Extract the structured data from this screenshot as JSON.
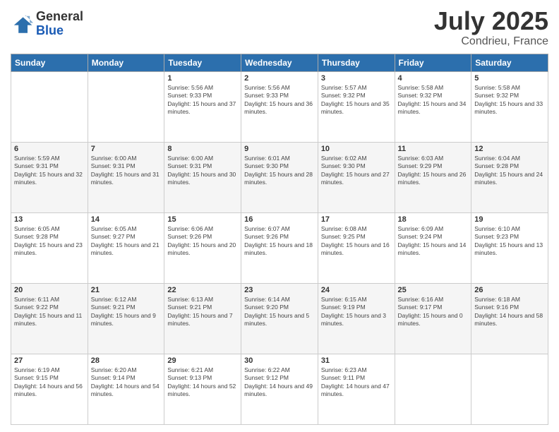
{
  "logo": {
    "general": "General",
    "blue": "Blue"
  },
  "title": {
    "month_year": "July 2025",
    "location": "Condrieu, France"
  },
  "headers": [
    "Sunday",
    "Monday",
    "Tuesday",
    "Wednesday",
    "Thursday",
    "Friday",
    "Saturday"
  ],
  "weeks": [
    [
      {
        "day": "",
        "info": ""
      },
      {
        "day": "",
        "info": ""
      },
      {
        "day": "1",
        "info": "Sunrise: 5:56 AM\nSunset: 9:33 PM\nDaylight: 15 hours and 37 minutes."
      },
      {
        "day": "2",
        "info": "Sunrise: 5:56 AM\nSunset: 9:33 PM\nDaylight: 15 hours and 36 minutes."
      },
      {
        "day": "3",
        "info": "Sunrise: 5:57 AM\nSunset: 9:32 PM\nDaylight: 15 hours and 35 minutes."
      },
      {
        "day": "4",
        "info": "Sunrise: 5:58 AM\nSunset: 9:32 PM\nDaylight: 15 hours and 34 minutes."
      },
      {
        "day": "5",
        "info": "Sunrise: 5:58 AM\nSunset: 9:32 PM\nDaylight: 15 hours and 33 minutes."
      }
    ],
    [
      {
        "day": "6",
        "info": "Sunrise: 5:59 AM\nSunset: 9:31 PM\nDaylight: 15 hours and 32 minutes."
      },
      {
        "day": "7",
        "info": "Sunrise: 6:00 AM\nSunset: 9:31 PM\nDaylight: 15 hours and 31 minutes."
      },
      {
        "day": "8",
        "info": "Sunrise: 6:00 AM\nSunset: 9:31 PM\nDaylight: 15 hours and 30 minutes."
      },
      {
        "day": "9",
        "info": "Sunrise: 6:01 AM\nSunset: 9:30 PM\nDaylight: 15 hours and 28 minutes."
      },
      {
        "day": "10",
        "info": "Sunrise: 6:02 AM\nSunset: 9:30 PM\nDaylight: 15 hours and 27 minutes."
      },
      {
        "day": "11",
        "info": "Sunrise: 6:03 AM\nSunset: 9:29 PM\nDaylight: 15 hours and 26 minutes."
      },
      {
        "day": "12",
        "info": "Sunrise: 6:04 AM\nSunset: 9:28 PM\nDaylight: 15 hours and 24 minutes."
      }
    ],
    [
      {
        "day": "13",
        "info": "Sunrise: 6:05 AM\nSunset: 9:28 PM\nDaylight: 15 hours and 23 minutes."
      },
      {
        "day": "14",
        "info": "Sunrise: 6:05 AM\nSunset: 9:27 PM\nDaylight: 15 hours and 21 minutes."
      },
      {
        "day": "15",
        "info": "Sunrise: 6:06 AM\nSunset: 9:26 PM\nDaylight: 15 hours and 20 minutes."
      },
      {
        "day": "16",
        "info": "Sunrise: 6:07 AM\nSunset: 9:26 PM\nDaylight: 15 hours and 18 minutes."
      },
      {
        "day": "17",
        "info": "Sunrise: 6:08 AM\nSunset: 9:25 PM\nDaylight: 15 hours and 16 minutes."
      },
      {
        "day": "18",
        "info": "Sunrise: 6:09 AM\nSunset: 9:24 PM\nDaylight: 15 hours and 14 minutes."
      },
      {
        "day": "19",
        "info": "Sunrise: 6:10 AM\nSunset: 9:23 PM\nDaylight: 15 hours and 13 minutes."
      }
    ],
    [
      {
        "day": "20",
        "info": "Sunrise: 6:11 AM\nSunset: 9:22 PM\nDaylight: 15 hours and 11 minutes."
      },
      {
        "day": "21",
        "info": "Sunrise: 6:12 AM\nSunset: 9:21 PM\nDaylight: 15 hours and 9 minutes."
      },
      {
        "day": "22",
        "info": "Sunrise: 6:13 AM\nSunset: 9:21 PM\nDaylight: 15 hours and 7 minutes."
      },
      {
        "day": "23",
        "info": "Sunrise: 6:14 AM\nSunset: 9:20 PM\nDaylight: 15 hours and 5 minutes."
      },
      {
        "day": "24",
        "info": "Sunrise: 6:15 AM\nSunset: 9:19 PM\nDaylight: 15 hours and 3 minutes."
      },
      {
        "day": "25",
        "info": "Sunrise: 6:16 AM\nSunset: 9:17 PM\nDaylight: 15 hours and 0 minutes."
      },
      {
        "day": "26",
        "info": "Sunrise: 6:18 AM\nSunset: 9:16 PM\nDaylight: 14 hours and 58 minutes."
      }
    ],
    [
      {
        "day": "27",
        "info": "Sunrise: 6:19 AM\nSunset: 9:15 PM\nDaylight: 14 hours and 56 minutes."
      },
      {
        "day": "28",
        "info": "Sunrise: 6:20 AM\nSunset: 9:14 PM\nDaylight: 14 hours and 54 minutes."
      },
      {
        "day": "29",
        "info": "Sunrise: 6:21 AM\nSunset: 9:13 PM\nDaylight: 14 hours and 52 minutes."
      },
      {
        "day": "30",
        "info": "Sunrise: 6:22 AM\nSunset: 9:12 PM\nDaylight: 14 hours and 49 minutes."
      },
      {
        "day": "31",
        "info": "Sunrise: 6:23 AM\nSunset: 9:11 PM\nDaylight: 14 hours and 47 minutes."
      },
      {
        "day": "",
        "info": ""
      },
      {
        "day": "",
        "info": ""
      }
    ]
  ]
}
